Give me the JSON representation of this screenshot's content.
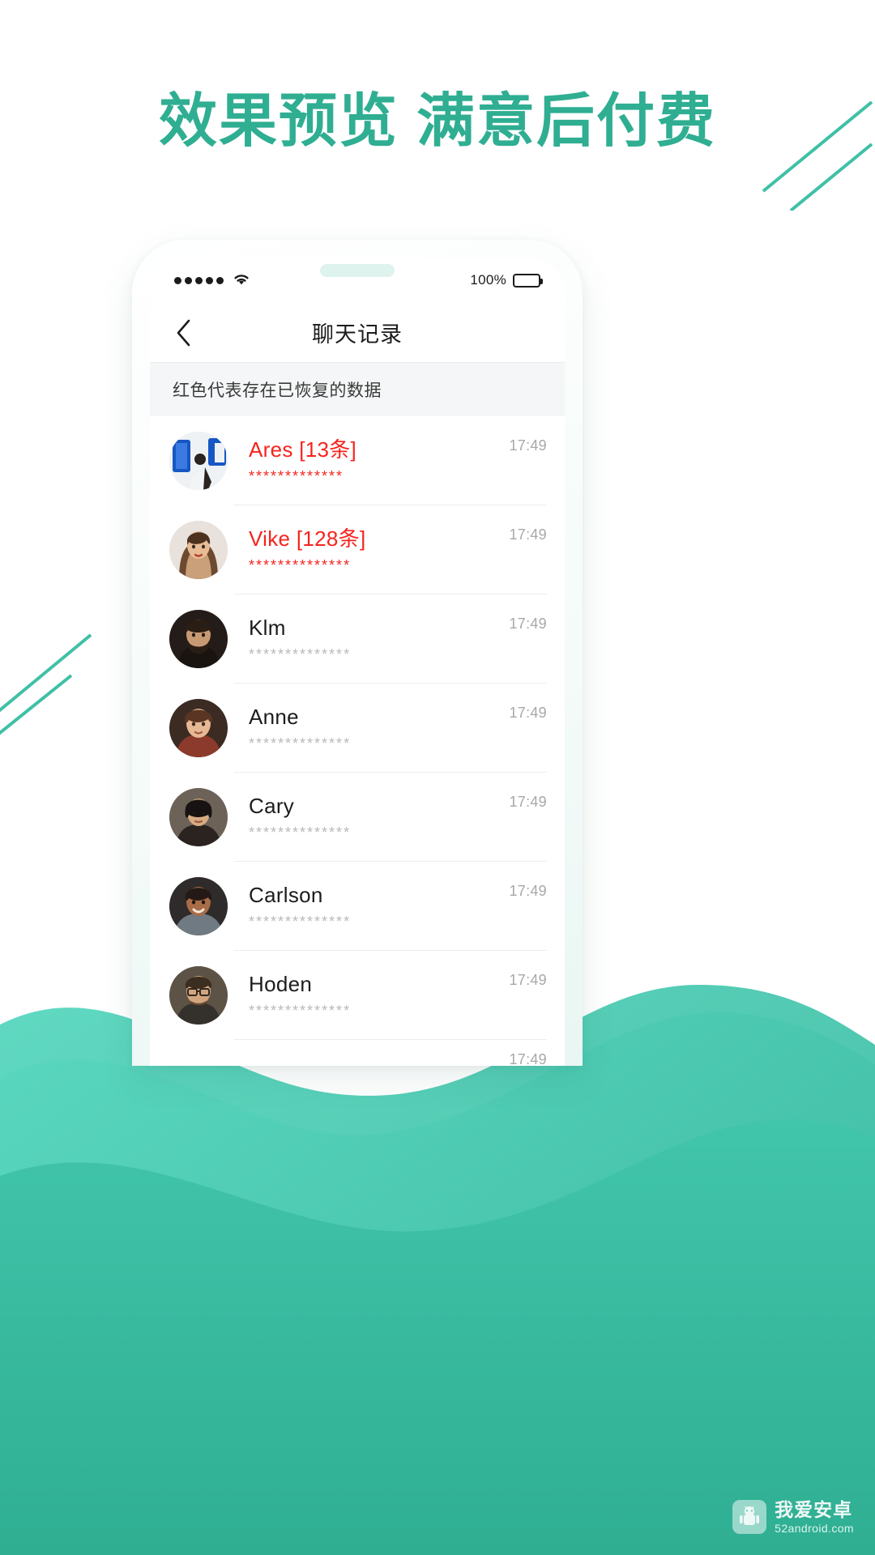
{
  "headline": "效果预览 满意后付费",
  "theme": {
    "accent": "#2FAE92",
    "accent_dark": "#27a08a",
    "danger": "#F5241F",
    "muted": "#b9b9b9"
  },
  "phone": {
    "status_bar": {
      "signal_icon": "signal-dots-icon",
      "wifi_icon": "wifi-icon",
      "battery_percent": "100%",
      "battery_icon": "battery-full-icon"
    },
    "nav": {
      "back_icon": "chevron-left-icon",
      "title": "聊天记录"
    },
    "notice": "红色代表存在已恢复的数据",
    "list": [
      {
        "name": "Ares",
        "count_label": "[13条]",
        "preview": "*************",
        "time": "17:49",
        "recovered": true,
        "avatar": "photo-man-blue-door"
      },
      {
        "name": "Vike",
        "count_label": "[128条]",
        "preview": "**************",
        "time": "17:49",
        "recovered": true,
        "avatar": "photo-woman-long-hair"
      },
      {
        "name": "Klm",
        "count_label": "",
        "preview": "**************",
        "time": "17:49",
        "recovered": false,
        "avatar": "photo-man-beard"
      },
      {
        "name": "Anne",
        "count_label": "",
        "preview": "**************",
        "time": "17:49",
        "recovered": false,
        "avatar": "photo-woman-short-hair"
      },
      {
        "name": "Cary",
        "count_label": "",
        "preview": "**************",
        "time": "17:49",
        "recovered": false,
        "avatar": "photo-woman-dark-hair"
      },
      {
        "name": "Carlson",
        "count_label": "",
        "preview": "**************",
        "time": "17:49",
        "recovered": false,
        "avatar": "photo-man-smiling"
      },
      {
        "name": "Hoden",
        "count_label": "",
        "preview": "**************",
        "time": "17:49",
        "recovered": false,
        "avatar": "photo-man-glasses"
      },
      {
        "name": "",
        "count_label": "",
        "preview": "",
        "time": "17:49",
        "recovered": false,
        "avatar": ""
      }
    ]
  },
  "watermark": {
    "title": "我爱安卓",
    "url": "52android.com",
    "logo_icon": "android-robot-icon"
  }
}
